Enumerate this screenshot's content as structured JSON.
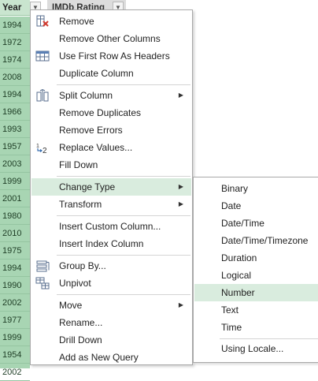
{
  "grid": {
    "year_header": "Year",
    "rating_header": "IMDb Rating",
    "years": [
      "1994",
      "1972",
      "1974",
      "2008",
      "1994",
      "1966",
      "1993",
      "1957",
      "2003",
      "1999",
      "2001",
      "1980",
      "2010",
      "1975",
      "1994",
      "1990",
      "2002",
      "1977",
      "1999",
      "1954",
      "2002"
    ]
  },
  "menu": {
    "remove": "Remove",
    "remove_other_columns": "Remove Other Columns",
    "use_first_row_as_headers": "Use First Row As Headers",
    "duplicate_column": "Duplicate Column",
    "split_column": "Split Column",
    "remove_duplicates": "Remove Duplicates",
    "remove_errors": "Remove Errors",
    "replace_values": "Replace Values...",
    "fill_down": "Fill Down",
    "change_type": "Change Type",
    "transform": "Transform",
    "insert_custom_column": "Insert Custom Column...",
    "insert_index_column": "Insert Index Column",
    "group_by": "Group By...",
    "unpivot": "Unpivot",
    "move": "Move",
    "rename": "Rename...",
    "drill_down": "Drill Down",
    "add_as_new_query": "Add as New Query",
    "replace_icon_text": "2"
  },
  "submenu": {
    "binary": "Binary",
    "date": "Date",
    "date_time": "Date/Time",
    "date_time_timezone": "Date/Time/Timezone",
    "duration": "Duration",
    "logical": "Logical",
    "number": "Number",
    "text": "Text",
    "time": "Time",
    "using_locale": "Using Locale..."
  },
  "colors": {
    "highlight": "#d9ecde",
    "year_column": "#a8d5b3"
  }
}
